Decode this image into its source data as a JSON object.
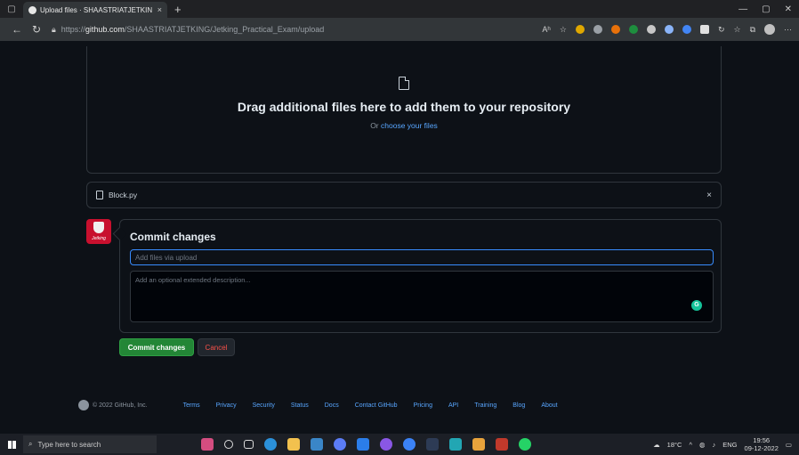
{
  "browser": {
    "tab_title": "Upload files · SHAASTRIATJETKIN",
    "tab_close": "×",
    "new_tab": "+",
    "url_prefix": "https://",
    "url_domain": "github.com",
    "url_path": "/SHAASTRIATJETKING/Jetking_Practical_Exam/upload",
    "read_aloud": "Aʰ",
    "window_controls": {
      "minimize": "—",
      "maximize": "▢",
      "close": "✕"
    }
  },
  "dropzone": {
    "headline": "Drag additional files here to add them to your repository",
    "or_text": "Or",
    "choose_link": "choose your files"
  },
  "file": {
    "name": "Block.py",
    "remove": "×"
  },
  "avatar": {
    "brand": "Jetking"
  },
  "commit": {
    "title": "Commit changes",
    "summary_placeholder": "Add files via upload",
    "description_placeholder": "Add an optional extended description...",
    "commit_button": "Commit changes",
    "cancel_button": "Cancel"
  },
  "footer": {
    "copyright": "© 2022 GitHub, Inc.",
    "links": [
      "Terms",
      "Privacy",
      "Security",
      "Status",
      "Docs",
      "Contact GitHub",
      "Pricing",
      "API",
      "Training",
      "Blog",
      "About"
    ]
  },
  "taskbar": {
    "search_placeholder": "Type here to search",
    "weather": "18°C",
    "language": "ENG",
    "time": "19:56",
    "date": "09-12-2022"
  },
  "colors": {
    "background": "#0d1117",
    "accent_blue": "#58a6ff",
    "primary_green": "#238636",
    "danger_red": "#f85149"
  }
}
